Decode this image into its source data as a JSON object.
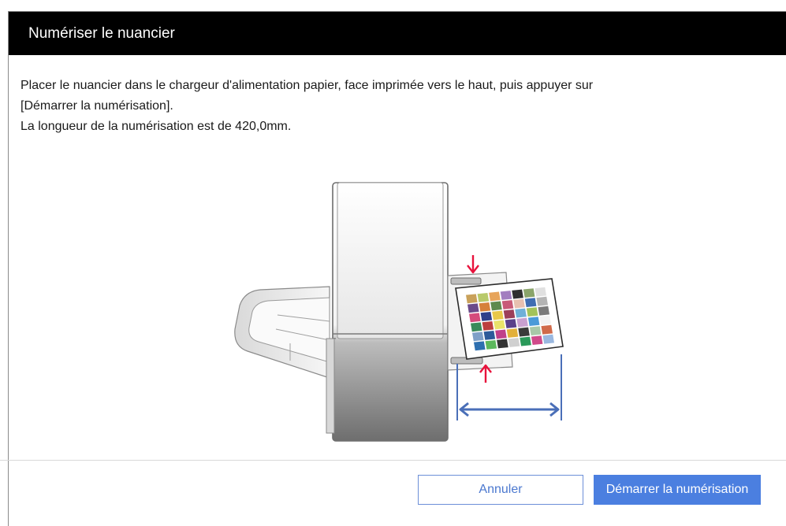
{
  "dialog": {
    "title": "Numériser le nuancier",
    "message_lines": [
      "Placer le nuancier dans le chargeur d'alimentation papier, face imprimée vers le haut, puis appuyer sur",
      "[Démarrer la numérisation].",
      "La longueur de la numérisation est de 420,0mm."
    ]
  },
  "illustration": {
    "icons": [
      "scanner-icon",
      "paper-guide-arrow-icon",
      "scan-length-arrow-icon"
    ],
    "accent_arrow_color": "#e8123c",
    "measure_color": "#4a6fb8",
    "swatch_colors": [
      [
        "#c9a15a",
        "#b8c96a",
        "#e7a45a",
        "#a37ec0",
        "#2f2f2f",
        "#8aa46a",
        "#e0e0e0"
      ],
      [
        "#6b4b8a",
        "#d6803a",
        "#5e8a4e",
        "#c85a78",
        "#e7c0b0",
        "#3f6db2",
        "#b4b4b4"
      ],
      [
        "#d54b7c",
        "#2f3f8a",
        "#e8c84a",
        "#9c3f5a",
        "#6fb0d8",
        "#a3c35a",
        "#7a7a7a"
      ],
      [
        "#3a8a5a",
        "#bc3f3f",
        "#e9e36a",
        "#5a3f8a",
        "#c9a0d0",
        "#4a9ad8",
        "#f2f2f2"
      ],
      [
        "#7fa0c8",
        "#2d5a9a",
        "#c03f8a",
        "#e2b03a",
        "#3a3a3a",
        "#a8c8a8",
        "#d06a4a"
      ],
      [
        "#2d6fb0",
        "#5cb85c",
        "#333333",
        "#d0d0d0",
        "#2a9a5a",
        "#d04a8a",
        "#9ab8e0"
      ]
    ]
  },
  "footer": {
    "cancel_label": "Annuler",
    "start_label": "Démarrer la numérisation"
  }
}
